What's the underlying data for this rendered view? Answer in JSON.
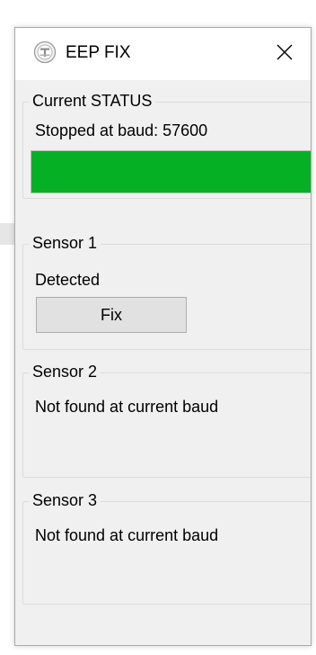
{
  "window": {
    "title": "EEP FIX",
    "close_symbol": "close-icon",
    "app_icon": "app-icon"
  },
  "status": {
    "group_label": "Current STATUS",
    "text": "Stopped at baud: 57600",
    "progress_percent": 100,
    "progress_color": "#06b025"
  },
  "sensors": [
    {
      "label": "Sensor 1",
      "status": "Detected",
      "button_label": "Fix"
    },
    {
      "label": "Sensor 2",
      "status": "Not found at current baud"
    },
    {
      "label": "Sensor 3",
      "status": "Not found at current baud"
    }
  ]
}
